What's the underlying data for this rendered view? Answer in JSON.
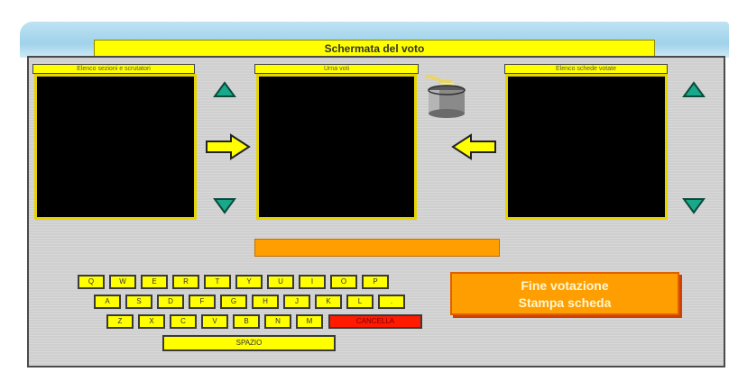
{
  "header": {
    "title": "Schermata del voto"
  },
  "panels": {
    "left_label": "Elenco sezioni e scrutatori",
    "center_label": "Urna voti",
    "right_label": "Elenco schede votate"
  },
  "keyboard": {
    "row1": [
      "Q",
      "W",
      "E",
      "R",
      "T",
      "Y",
      "U",
      "I",
      "O",
      "P"
    ],
    "row2": [
      "A",
      "S",
      "D",
      "F",
      "G",
      "H",
      "J",
      "K",
      "L",
      "."
    ],
    "row3": [
      "Z",
      "X",
      "C",
      "V",
      "B",
      "N",
      "M"
    ],
    "cancel_label": "CANCELLA",
    "space_label": "SPAZIO"
  },
  "finish_button": {
    "line1": "Fine votazione",
    "line2": "Stampa scheda"
  },
  "colors": {
    "yellow": "#ffff00",
    "orange": "#ff9e00",
    "red": "#ff1a00",
    "teal": "#1aa88a"
  },
  "icons": [
    "arrow-up-icon",
    "arrow-down-icon",
    "arrow-right-icon",
    "arrow-left-icon",
    "ballot-pot-icon"
  ]
}
